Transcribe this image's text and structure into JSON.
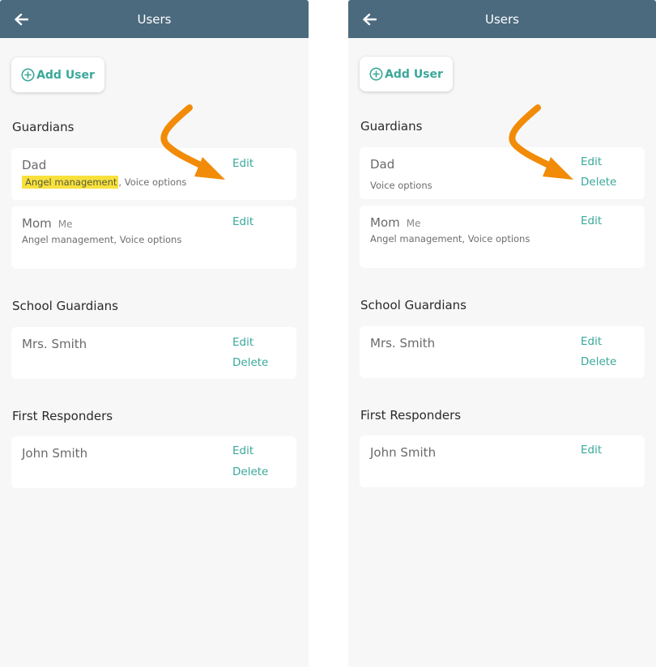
{
  "colors": {
    "header": "#4c6a7e",
    "accent": "#3aa89a",
    "highlight": "#f8e13c",
    "annotation_arrow": "#f28b07"
  },
  "screens": [
    {
      "title": "Users",
      "add_user_label": "Add User",
      "sections": [
        {
          "title": "Guardians",
          "users": [
            {
              "name": "Dad",
              "tag": "",
              "perm_highlight": "Angel management",
              "perm_rest": ", Voice options",
              "actions": [
                "Edit"
              ]
            },
            {
              "name": "Mom",
              "tag": "Me",
              "perm_highlight": "",
              "perm_rest": "Angel management, Voice options",
              "actions": [
                "Edit"
              ]
            }
          ]
        },
        {
          "title": "School Guardians",
          "users": [
            {
              "name": "Mrs. Smith",
              "tag": "",
              "actions": [
                "Edit",
                "Delete"
              ]
            }
          ]
        },
        {
          "title": "First Responders",
          "users": [
            {
              "name": "John Smith",
              "tag": "",
              "actions": [
                "Edit",
                "Delete"
              ]
            }
          ]
        }
      ]
    },
    {
      "title": "Users",
      "add_user_label": "Add User",
      "sections": [
        {
          "title": "Guardians",
          "users": [
            {
              "name": "Dad",
              "tag": "",
              "perm_highlight": "",
              "perm_rest": "Voice options",
              "actions": [
                "Edit",
                "Delete"
              ]
            },
            {
              "name": "Mom",
              "tag": "Me",
              "perm_highlight": "",
              "perm_rest": "Angel management, Voice options",
              "actions": [
                "Edit"
              ]
            }
          ]
        },
        {
          "title": "School Guardians",
          "users": [
            {
              "name": "Mrs. Smith",
              "tag": "",
              "actions": [
                "Edit",
                "Delete"
              ]
            }
          ]
        },
        {
          "title": "First Responders",
          "users": [
            {
              "name": "John Smith",
              "tag": "",
              "actions": [
                "Edit"
              ]
            }
          ]
        }
      ]
    }
  ],
  "icons": {
    "back": "arrow-left-icon",
    "add": "plus-circle-icon",
    "annotation": "curved-arrow-icon"
  }
}
